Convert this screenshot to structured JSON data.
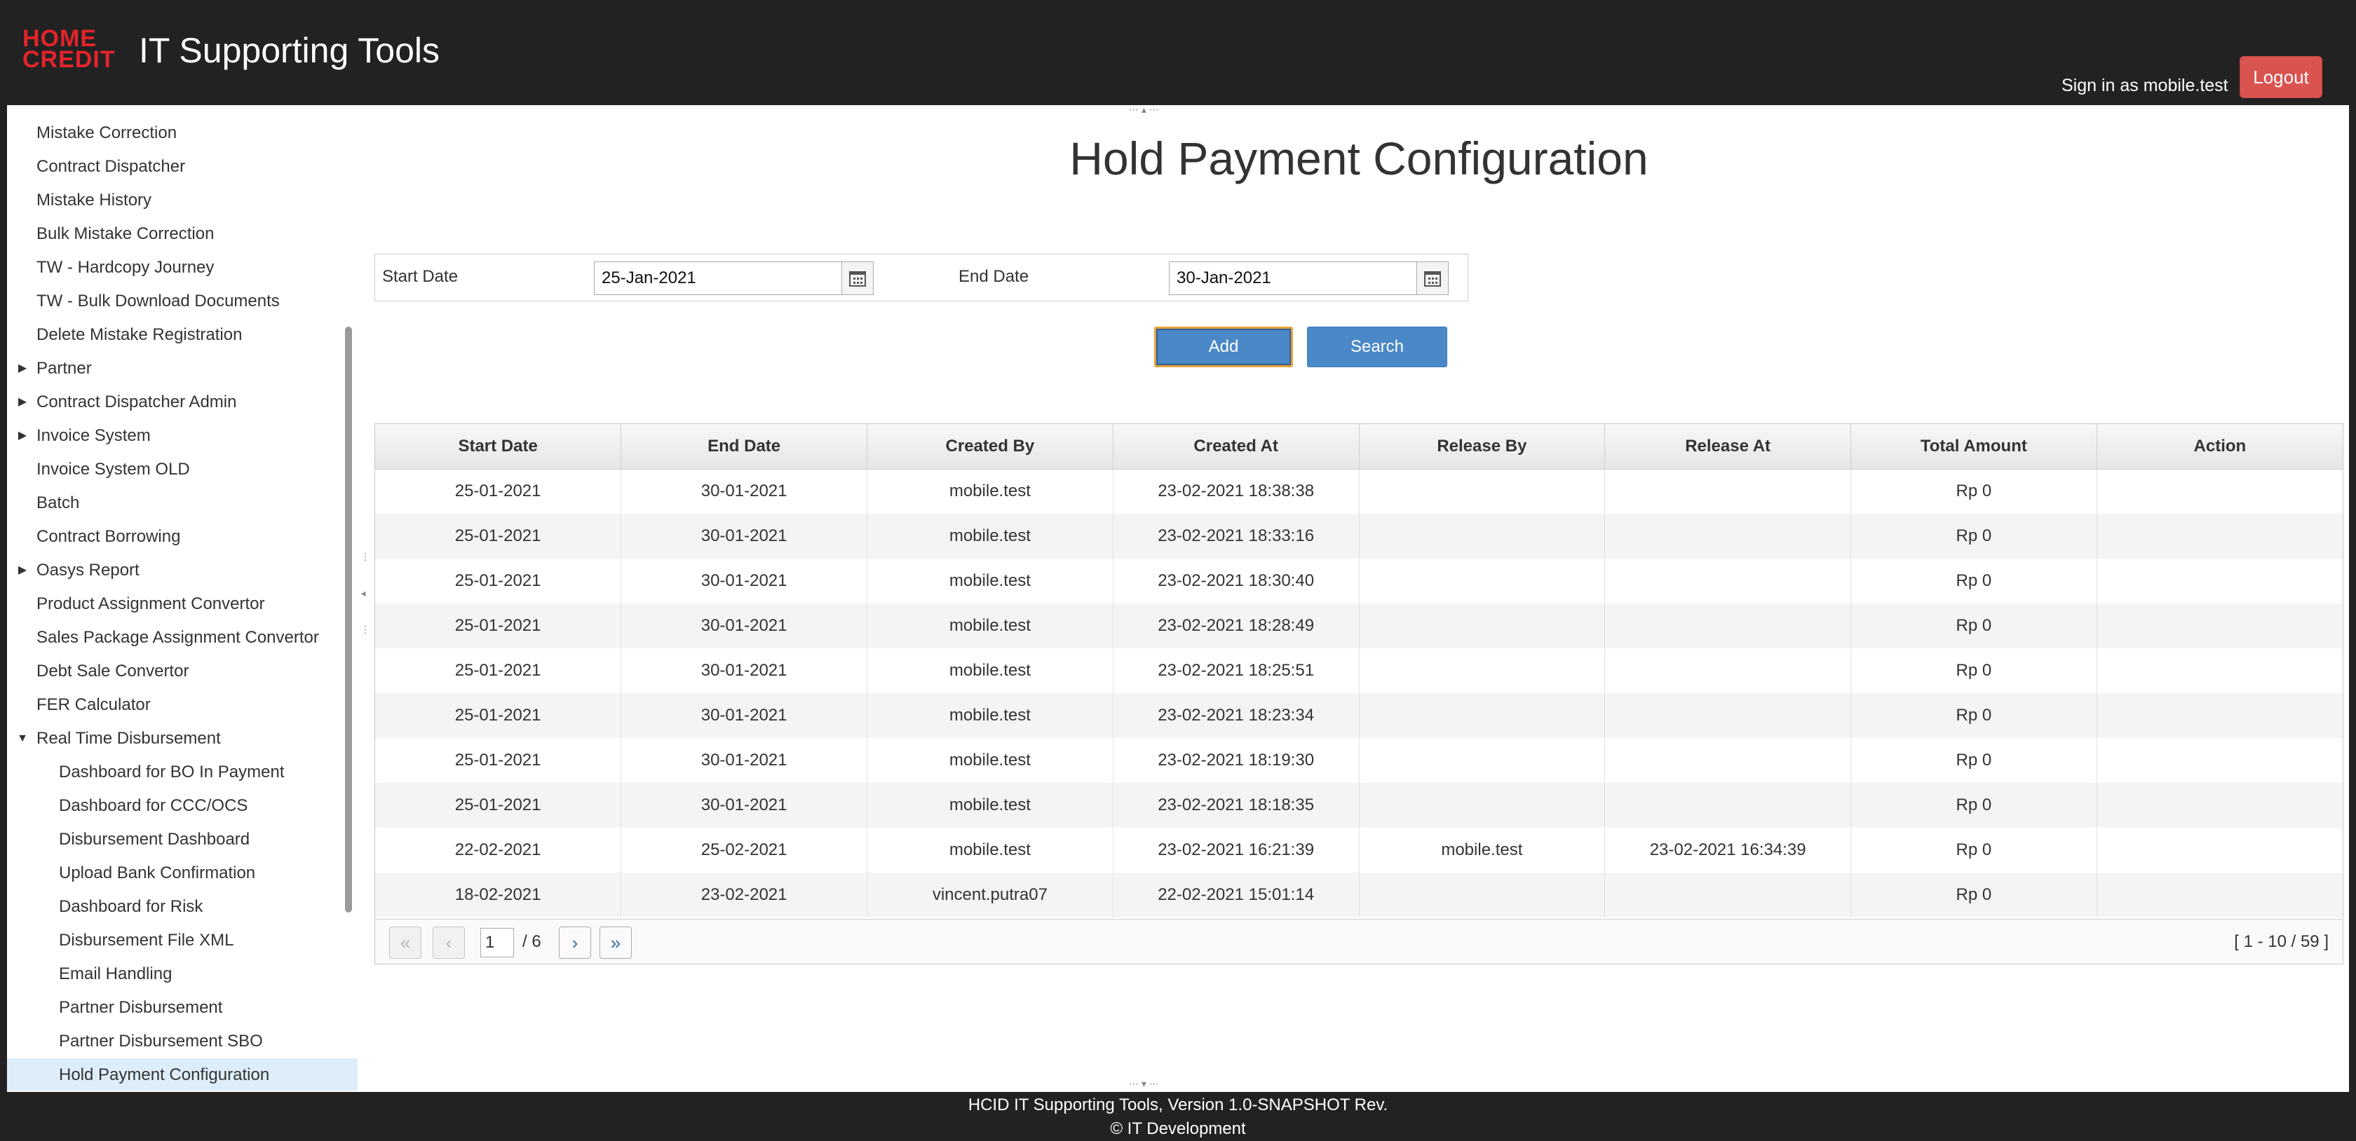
{
  "header": {
    "logo_line1": "HOME",
    "logo_line2": "CREDIT",
    "title": "IT Supporting Tools",
    "signin_text": "Sign in as mobile.test",
    "logout_label": "Logout",
    "brand_color": "#e3242b"
  },
  "sidebar": {
    "items": [
      {
        "label": "Mistake Correction",
        "level": 1
      },
      {
        "label": "Contract Dispatcher",
        "level": 1
      },
      {
        "label": "Mistake History",
        "level": 1
      },
      {
        "label": "Bulk Mistake Correction",
        "level": 1
      },
      {
        "label": "TW - Hardcopy Journey",
        "level": 1
      },
      {
        "label": "TW - Bulk Download Documents",
        "level": 1
      },
      {
        "label": "Delete Mistake Registration",
        "level": 1
      },
      {
        "label": "Partner",
        "level": 1,
        "expander": "collapsed"
      },
      {
        "label": "Contract Dispatcher Admin",
        "level": 1,
        "expander": "collapsed"
      },
      {
        "label": "Invoice System",
        "level": 1,
        "expander": "collapsed"
      },
      {
        "label": "Invoice System OLD",
        "level": 1
      },
      {
        "label": "Batch",
        "level": 1
      },
      {
        "label": "Contract Borrowing",
        "level": 1
      },
      {
        "label": "Oasys Report",
        "level": 1,
        "expander": "collapsed"
      },
      {
        "label": "Product Assignment Convertor",
        "level": 1
      },
      {
        "label": "Sales Package Assignment Convertor",
        "level": 1
      },
      {
        "label": "Debt Sale Convertor",
        "level": 1
      },
      {
        "label": "FER Calculator",
        "level": 1
      },
      {
        "label": "Real Time Disbursement",
        "level": 1,
        "expander": "expanded"
      },
      {
        "label": "Dashboard for BO In Payment",
        "level": 2
      },
      {
        "label": "Dashboard for CCC/OCS",
        "level": 2
      },
      {
        "label": "Disbursement Dashboard",
        "level": 2
      },
      {
        "label": "Upload Bank Confirmation",
        "level": 2
      },
      {
        "label": "Dashboard for Risk",
        "level": 2
      },
      {
        "label": "Disbursement File XML",
        "level": 2
      },
      {
        "label": "Email Handling",
        "level": 2
      },
      {
        "label": "Partner Disbursement",
        "level": 2
      },
      {
        "label": "Partner Disbursement SBO",
        "level": 2
      },
      {
        "label": "Hold Payment Configuration",
        "level": 2,
        "active": true
      }
    ]
  },
  "main": {
    "page_title": "Hold Payment Configuration",
    "filter": {
      "start_label": "Start Date",
      "start_value": "25-Jan-2021",
      "end_label": "End Date",
      "end_value": "30-Jan-2021"
    },
    "buttons": {
      "add_label": "Add",
      "search_label": "Search",
      "accent_color": "#4a88c7"
    },
    "table": {
      "columns": [
        "Start Date",
        "End Date",
        "Created By",
        "Created At",
        "Release By",
        "Release At",
        "Total Amount",
        "Action"
      ],
      "rows": [
        [
          "25-01-2021",
          "30-01-2021",
          "mobile.test",
          "23-02-2021 18:38:38",
          "",
          "",
          "Rp 0",
          ""
        ],
        [
          "25-01-2021",
          "30-01-2021",
          "mobile.test",
          "23-02-2021 18:33:16",
          "",
          "",
          "Rp 0",
          ""
        ],
        [
          "25-01-2021",
          "30-01-2021",
          "mobile.test",
          "23-02-2021 18:30:40",
          "",
          "",
          "Rp 0",
          ""
        ],
        [
          "25-01-2021",
          "30-01-2021",
          "mobile.test",
          "23-02-2021 18:28:49",
          "",
          "",
          "Rp 0",
          ""
        ],
        [
          "25-01-2021",
          "30-01-2021",
          "mobile.test",
          "23-02-2021 18:25:51",
          "",
          "",
          "Rp 0",
          ""
        ],
        [
          "25-01-2021",
          "30-01-2021",
          "mobile.test",
          "23-02-2021 18:23:34",
          "",
          "",
          "Rp 0",
          ""
        ],
        [
          "25-01-2021",
          "30-01-2021",
          "mobile.test",
          "23-02-2021 18:19:30",
          "",
          "",
          "Rp 0",
          ""
        ],
        [
          "25-01-2021",
          "30-01-2021",
          "mobile.test",
          "23-02-2021 18:18:35",
          "",
          "",
          "Rp 0",
          ""
        ],
        [
          "22-02-2021",
          "25-02-2021",
          "mobile.test",
          "23-02-2021 16:21:39",
          "mobile.test",
          "23-02-2021 16:34:39",
          "Rp 0",
          ""
        ],
        [
          "18-02-2021",
          "23-02-2021",
          "vincent.putra07",
          "22-02-2021 15:01:14",
          "",
          "",
          "Rp 0",
          ""
        ]
      ]
    },
    "paginator": {
      "current_page": "1",
      "total_pages": "/ 6",
      "summary": "[ 1 - 10 / 59 ]",
      "first_icon": "double-chevron-left-icon",
      "prev_icon": "chevron-left-icon",
      "next_icon": "chevron-right-icon",
      "last_icon": "double-chevron-right-icon"
    }
  },
  "footer": {
    "line1": "HCID IT Supporting Tools, Version 1.0-SNAPSHOT Rev.",
    "line2": "© IT Development"
  }
}
